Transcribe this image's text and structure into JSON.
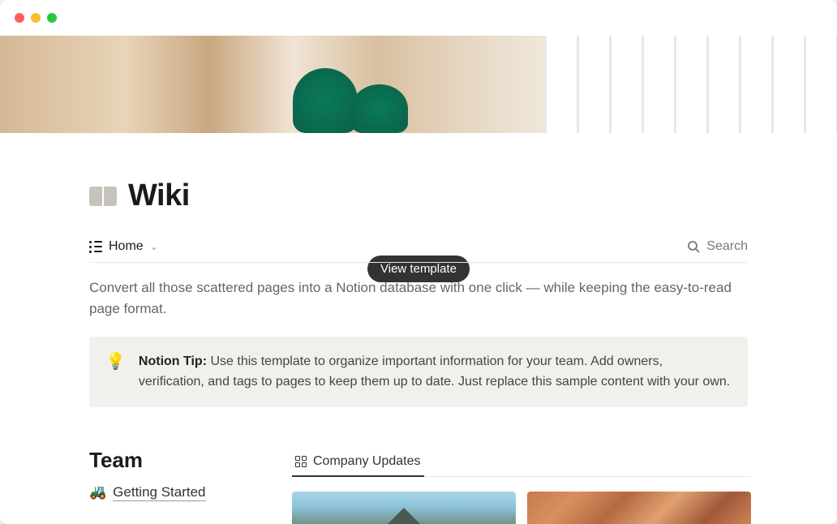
{
  "page": {
    "title": "Wiki",
    "icon": "book-icon"
  },
  "toolbar": {
    "view_name": "Home",
    "search_label": "Search"
  },
  "description": "Convert all those scattered pages into a Notion database with one click — while keeping the easy-to-read page format.",
  "callout": {
    "icon": "💡",
    "label": "Notion Tip:",
    "text": " Use this template to organize important information for your team. Add owners, verification, and tags to pages to keep them up to date. Just replace this sample content with your own."
  },
  "tooltip": {
    "label": "View template"
  },
  "sections": {
    "team": {
      "heading": "Team",
      "links": [
        {
          "icon": "🚜",
          "label": "Getting Started"
        }
      ]
    },
    "updates": {
      "tab_label": "Company Updates"
    }
  }
}
